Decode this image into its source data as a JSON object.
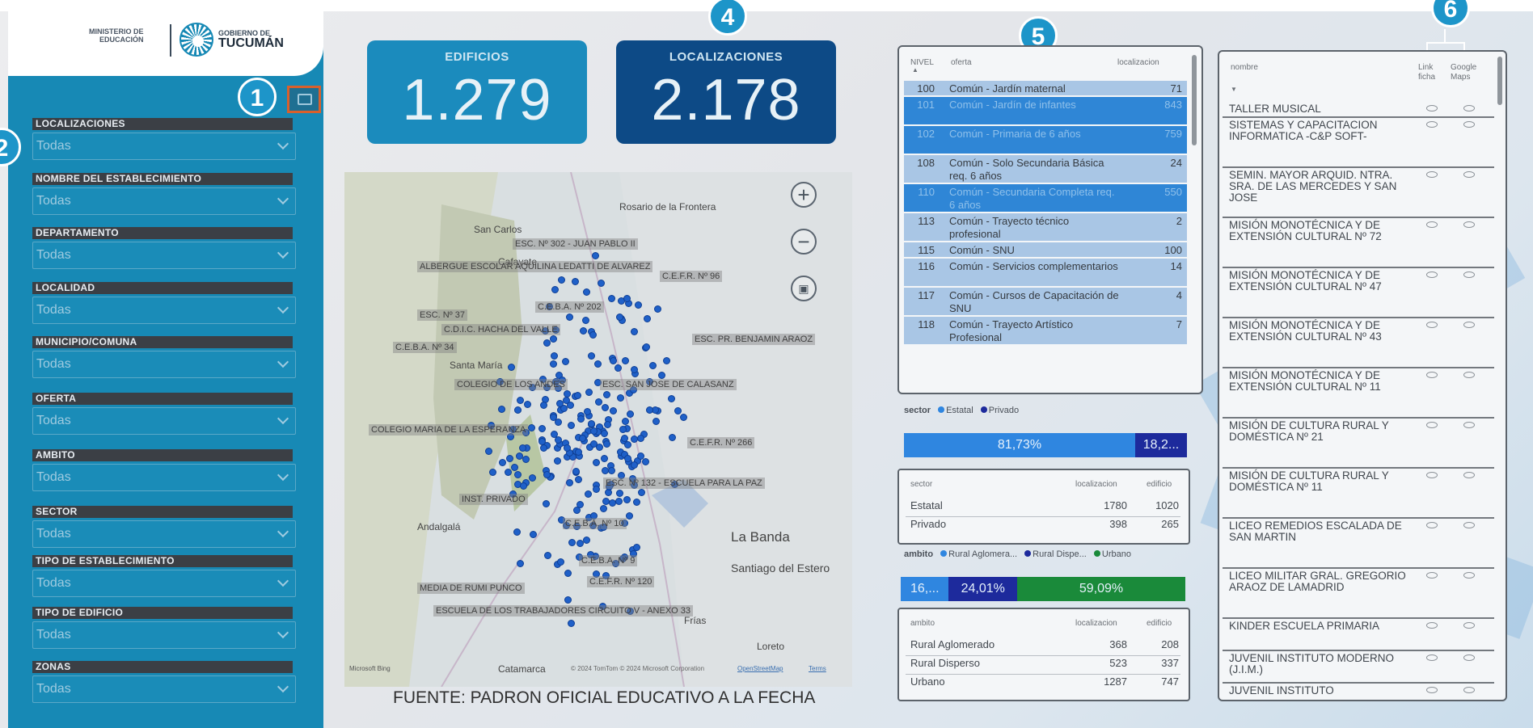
{
  "logo": {
    "ministry_line1": "MINISTERIO DE",
    "ministry_line2": "EDUCACIÓN",
    "gov_line1": "GOBIERNO DE",
    "gov_line2": "TUCUMÁN"
  },
  "badges": [
    "1",
    "2",
    "3",
    "4",
    "5",
    "6"
  ],
  "filters": [
    {
      "label": "LOCALIZACIONES",
      "value": "Todas"
    },
    {
      "label": "NOMBRE DEL ESTABLECIMIENTO",
      "value": "Todas"
    },
    {
      "label": "DEPARTAMENTO",
      "value": "Todas"
    },
    {
      "label": "LOCALIDAD",
      "value": "Todas"
    },
    {
      "label": "MUNICIPIO/COMUNA",
      "value": "Todas"
    },
    {
      "label": "OFERTA",
      "value": "Todas"
    },
    {
      "label": "AMBITO",
      "value": "Todas"
    },
    {
      "label": "SECTOR",
      "value": "Todas"
    },
    {
      "label": "TIPO DE ESTABLECIMIENTO",
      "value": "Todas"
    },
    {
      "label": "TIPO DE EDIFICIO",
      "value": "Todas"
    },
    {
      "label": "ZONAS",
      "value": "Todas"
    }
  ],
  "kpis": [
    {
      "title": "EDIFICIOS",
      "value": "1.279",
      "color": "#1b8bbd"
    },
    {
      "title": "LOCALIZACIONES",
      "value": "2.178",
      "color": "#0d4a86"
    }
  ],
  "map": {
    "labels": [
      "ESC. Nº 302 - JUAN PABLO II",
      "ALBERGUE ESCOLAR AQUILINA LEDATTI DE ALVAREZ",
      "ESC. Nº 37",
      "C.E.B.A. Nº 202",
      "C.D.I.C. HACHA DEL VALLE",
      "C.E.B.A. Nº 34",
      "ESC. PR. BENJAMIN ARAOZ",
      "COLEGIO DE LOS ANDES",
      "ESC. SAN JOSE DE CALASANZ",
      "COLEGIO MARIA DE LA ESPERANZA",
      "C.E.F.R. Nº 266",
      "ESC. Nº 132 - ESCUELA PARA LA PAZ",
      "INST. PRIVADO",
      "C.E.B.A. Nº 10",
      "C.E.B.A. Nº 9",
      "MEDIA DE RUMI PUNCO",
      "ESCUELA DE LOS TRABAJADORES CIRCUITO V - ANEXO 33",
      "C.E.F.R. Nº 96",
      "C.E.F.R. Nº 120"
    ],
    "places": [
      "Rosario de la Frontera",
      "San Carlos",
      "Cafayate",
      "Santa María",
      "Andalgalá",
      "La Banda",
      "Santiago del Estero",
      "Catamarca",
      "Loreto",
      "Frías"
    ],
    "zoom_in": "+",
    "zoom_out": "−",
    "attribution": "© 2024 TomTom © 2024 Microsoft Corporation",
    "terms": "Terms",
    "openstreetmap": "OpenStreetMap",
    "bing": "Microsoft Bing",
    "source": "FUENTE: PADRON OFICIAL EDUCATIVO A LA FECHA"
  },
  "oferta_table": {
    "headers": [
      "NIVEL",
      "oferta",
      "localizacion"
    ],
    "rows": [
      {
        "nivel": "100",
        "oferta": "Común - Jardín maternal",
        "loc": "71",
        "selected": false
      },
      {
        "nivel": "101",
        "oferta": "Común - Jardín de infantes",
        "loc": "843",
        "selected": true
      },
      {
        "nivel": "102",
        "oferta": "Común - Primaria de 6 años",
        "loc": "759",
        "selected": true
      },
      {
        "nivel": "108",
        "oferta": "Común - Solo Secundaria Básica req. 6 años",
        "loc": "24",
        "selected": false
      },
      {
        "nivel": "110",
        "oferta": "Común - Secundaria Completa req. 6 años",
        "loc": "550",
        "selected": true
      },
      {
        "nivel": "113",
        "oferta": "Común - Trayecto técnico profesional",
        "loc": "2",
        "selected": false
      },
      {
        "nivel": "115",
        "oferta": "Común - SNU",
        "loc": "100",
        "selected": false
      },
      {
        "nivel": "116",
        "oferta": "Común - Servicios complementarios",
        "loc": "14",
        "selected": false
      },
      {
        "nivel": "117",
        "oferta": "Común - Cursos de Capacitación de SNU",
        "loc": "4",
        "selected": false
      },
      {
        "nivel": "118",
        "oferta": "Común - Trayecto Artístico Profesional",
        "loc": "7",
        "selected": false
      }
    ]
  },
  "sector": {
    "legend_title": "sector",
    "legend": [
      {
        "name": "Estatal",
        "color": "#2f86e0"
      },
      {
        "name": "Privado",
        "color": "#1d2a9c"
      }
    ],
    "bar": [
      {
        "label": "81,73%",
        "percent": 81.73,
        "color": "#2f86e0"
      },
      {
        "label": "18,2...",
        "percent": 18.27,
        "color": "#1d2a9c"
      }
    ],
    "table": {
      "headers": [
        "sector",
        "localizacion",
        "edificio"
      ],
      "rows": [
        {
          "name": "Estatal",
          "loc": "1780",
          "edif": "1020"
        },
        {
          "name": "Privado",
          "loc": "398",
          "edif": "265"
        }
      ]
    }
  },
  "ambito": {
    "legend_title": "ambito",
    "legend": [
      {
        "name": "Rural Aglomera...",
        "color": "#2f86e0"
      },
      {
        "name": "Rural Dispe...",
        "color": "#1d2a9c"
      },
      {
        "name": "Urbano",
        "color": "#1a8a3a"
      }
    ],
    "bar": [
      {
        "label": "16,...",
        "percent": 16.9,
        "color": "#2f86e0"
      },
      {
        "label": "24,01%",
        "percent": 24.01,
        "color": "#1d2a9c"
      },
      {
        "label": "59,09%",
        "percent": 59.09,
        "color": "#1a8a3a"
      }
    ],
    "table": {
      "headers": [
        "ambito",
        "localizacion",
        "edificio"
      ],
      "rows": [
        {
          "name": "Rural Aglomerado",
          "loc": "368",
          "edif": "208"
        },
        {
          "name": "Rural Disperso",
          "loc": "523",
          "edif": "337"
        },
        {
          "name": "Urbano",
          "loc": "1287",
          "edif": "747"
        }
      ]
    }
  },
  "names_table": {
    "headers": {
      "nombre": "nombre",
      "link": "Link ficha",
      "maps": "Google Maps"
    },
    "rows": [
      "TALLER MUSICAL",
      "SISTEMAS Y CAPACITACION INFORMATICA -C&P SOFT-",
      "SEMIN. MAYOR ARQUID. NTRA. SRA. DE LAS MERCEDES Y SAN JOSE",
      "MISIÓN MONOTÉCNICA Y DE EXTENSIÓN CULTURAL Nº 72",
      "MISIÓN MONOTÉCNICA Y DE EXTENSIÓN CULTURAL Nº 47",
      "MISIÓN MONOTÉCNICA Y DE EXTENSIÓN CULTURAL Nº 43",
      "MISIÓN MONOTÉCNICA Y DE EXTENSIÓN CULTURAL Nº 11",
      "MISIÓN DE CULTURA RURAL Y DOMÉSTICA Nº 21",
      "MISIÓN DE CULTURA RURAL Y DOMÉSTICA Nº 11",
      "LICEO REMEDIOS ESCALADA DE SAN MARTIN",
      "LICEO MILITAR GRAL. GREGORIO ARAOZ DE LAMADRID",
      "KINDER ESCUELA PRIMARIA",
      "JUVENIL INSTITUTO MODERNO (J.I.M.)",
      "JUVENIL INSTITUTO"
    ]
  }
}
